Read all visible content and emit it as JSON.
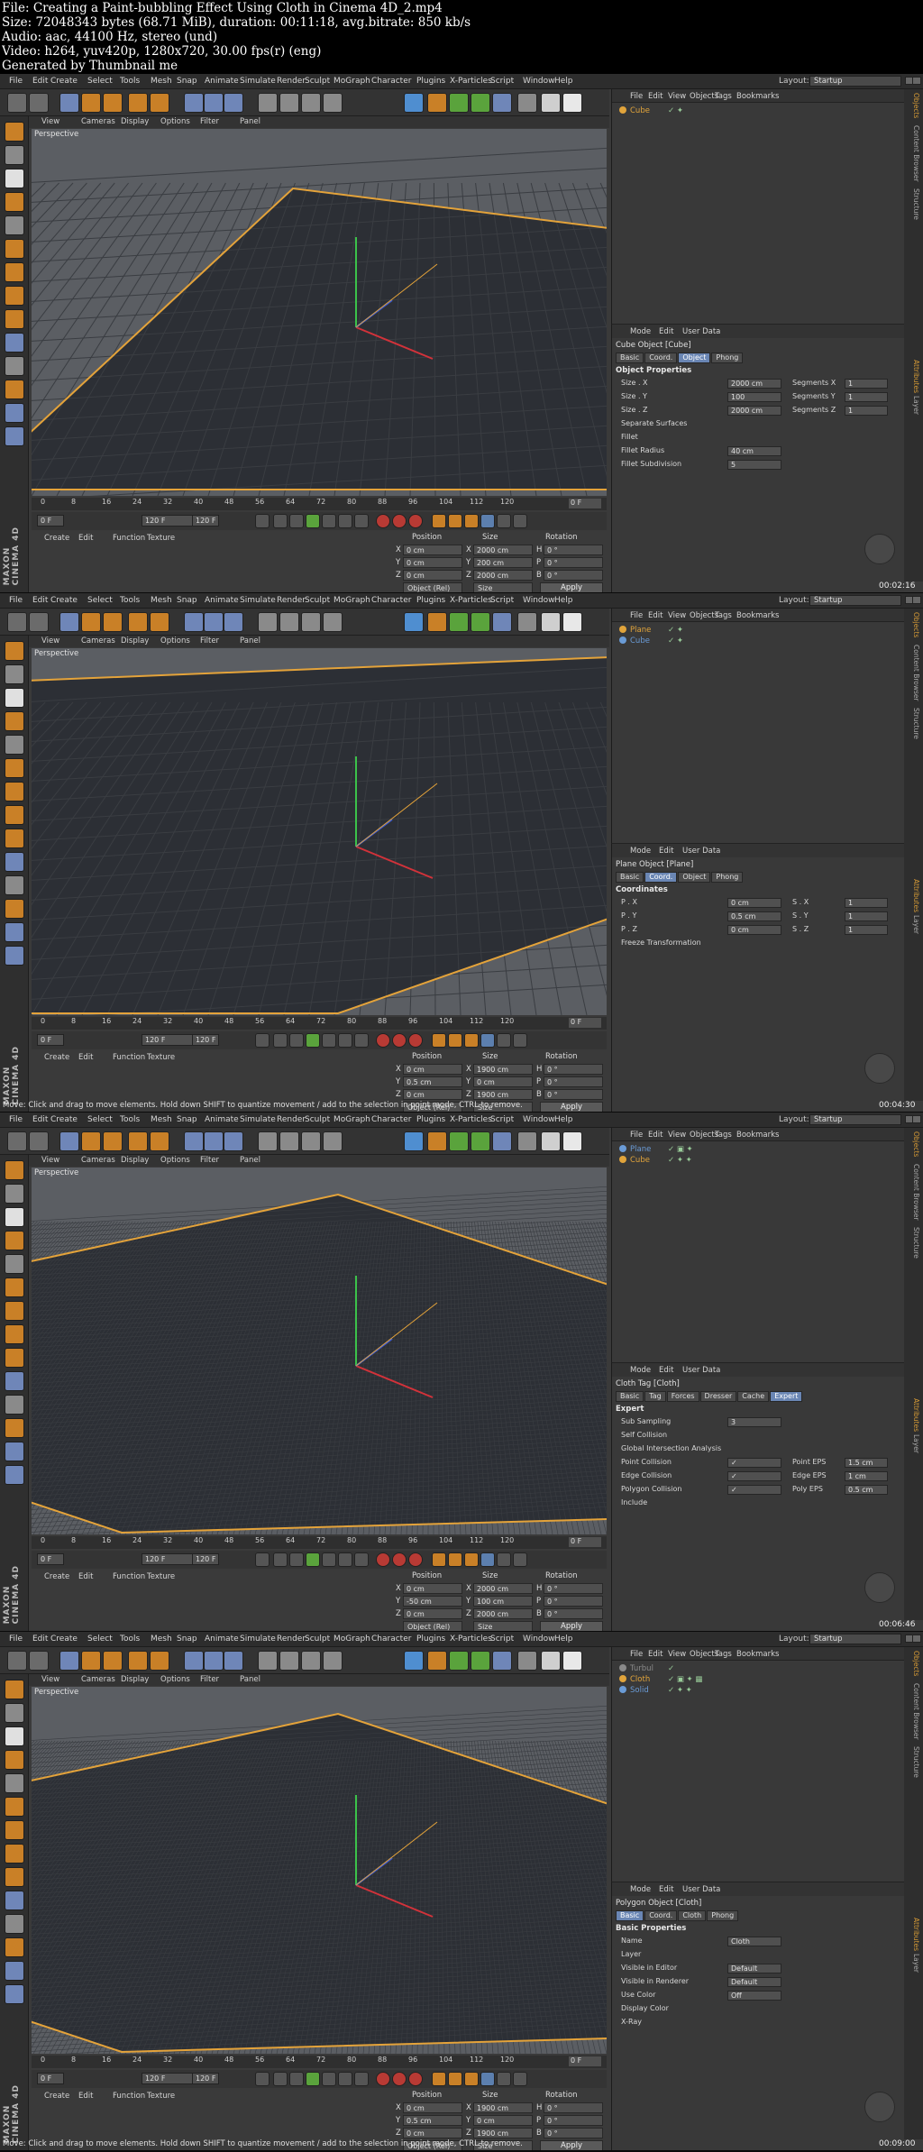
{
  "header": {
    "lines": [
      "File: Creating a Paint-bubbling Effect Using Cloth in Cinema 4D_2.mp4",
      "Size: 72048343 bytes (68.71 MiB), duration: 00:11:18, avg.bitrate: 850 kb/s",
      "Audio: aac, 44100 Hz, stereo (und)",
      "Video: h264, yuv420p, 1280x720, 30.00 fps(r) (eng)",
      "Generated by Thumbnail me"
    ]
  },
  "app": {
    "menu": [
      "File",
      "Edit",
      "Create",
      "Select",
      "Tools",
      "Mesh",
      "Snap",
      "Animate",
      "Simulate",
      "Render",
      "Sculpt",
      "MoGraph",
      "Character",
      "Plugins",
      "X-Particles",
      "Script",
      "Window",
      "Help"
    ],
    "layout_label": "Layout:",
    "layout_value": "Startup",
    "viewport_menu": [
      "View",
      "Cameras",
      "Display",
      "Options",
      "Filter",
      "Panel"
    ],
    "viewport_label": "Perspective",
    "timeline_ticks": [
      "0",
      "8",
      "16",
      "24",
      "32",
      "40",
      "48",
      "56",
      "64",
      "72",
      "80",
      "88",
      "96",
      "104",
      "112",
      "120"
    ],
    "frame_end_field": "0 F",
    "transport_fields": [
      "0 F",
      "120 F",
      "120 F"
    ],
    "material_menu": [
      "Create",
      "Edit",
      "Function",
      "Texture"
    ],
    "coord_headers": [
      "Position",
      "Size",
      "Rotation"
    ],
    "coord_axes": [
      "X",
      "Y",
      "Z"
    ],
    "coord_rot_axes": [
      "H",
      "P",
      "B"
    ],
    "coord_buttons": [
      "Object (Rel)",
      "Size",
      "Apply"
    ],
    "object_menu": [
      "File",
      "Edit",
      "View",
      "Objects",
      "Tags",
      "Bookmarks"
    ],
    "attr_menu": [
      "Mode",
      "Edit",
      "User Data"
    ],
    "brand_line1": "MAXON",
    "brand_line2": "CINEMA 4D",
    "side_tabs": [
      "Objects",
      "Content Browser",
      "Structure",
      "Attributes",
      "Layer"
    ]
  },
  "frames": [
    {
      "timestamp": "00:02:16",
      "status": "",
      "objects": [
        {
          "name": "Cube",
          "color": "#e1a43b",
          "icon": "cube-icon",
          "tags": "✓ ✦"
        }
      ],
      "attr_title": "Cube Object [Cube]",
      "attr_tabs": [
        "Basic",
        "Coord.",
        "Object",
        "Phong"
      ],
      "attr_active_tab": "Object",
      "attr_section": "Object Properties",
      "attr_rows": [
        {
          "label": "Size . X",
          "value": "2000 cm",
          "label2": "Segments X",
          "value2": "1"
        },
        {
          "label": "Size . Y",
          "value": "100",
          "label2": "Segments Y",
          "value2": "1"
        },
        {
          "label": "Size . Z",
          "value": "2000 cm",
          "label2": "Segments Z",
          "value2": "1"
        },
        {
          "label": "Separate Surfaces",
          "value": "",
          "label2": "",
          "value2": ""
        },
        {
          "label": "Fillet",
          "value": "",
          "label2": "",
          "value2": ""
        },
        {
          "label": "Fillet Radius",
          "value": "40 cm",
          "label2": "",
          "value2": ""
        },
        {
          "label": "Fillet Subdivision",
          "value": "5",
          "label2": "",
          "value2": ""
        }
      ],
      "coords": {
        "pos": [
          "0 cm",
          "0 cm",
          "0 cm"
        ],
        "size": [
          "2000 cm",
          "200 cm",
          "2000 cm"
        ],
        "rot": [
          "0 °",
          "0 °",
          "0 °"
        ]
      }
    },
    {
      "timestamp": "00:04:30",
      "status": "Move: Click and drag to move elements. Hold down SHIFT to quantize movement / add to the selection in point mode, CTRL to remove.",
      "objects": [
        {
          "name": "Plane",
          "color": "#e1a43b",
          "icon": "plane-icon",
          "tags": "✓ ✦"
        },
        {
          "name": "Cube",
          "color": "#6a9bd6",
          "icon": "cube-icon",
          "tags": "✓ ✦"
        }
      ],
      "attr_title": "Plane Object [Plane]",
      "attr_tabs": [
        "Basic",
        "Coord.",
        "Object",
        "Phong"
      ],
      "attr_active_tab": "Coord.",
      "attr_section": "Coordinates",
      "attr_rows": [
        {
          "label": "P . X",
          "value": "0 cm",
          "label2": "S . X",
          "value2": "1"
        },
        {
          "label": "P . Y",
          "value": "0.5 cm",
          "label2": "S . Y",
          "value2": "1"
        },
        {
          "label": "P . Z",
          "value": "0 cm",
          "label2": "S . Z",
          "value2": "1"
        },
        {
          "label": "Freeze Transformation",
          "value": "",
          "label2": "",
          "value2": ""
        }
      ],
      "coords": {
        "pos": [
          "0 cm",
          "0.5 cm",
          "0 cm"
        ],
        "size": [
          "1900 cm",
          "0 cm",
          "1900 cm"
        ],
        "rot": [
          "0 °",
          "0 °",
          "0 °"
        ]
      }
    },
    {
      "timestamp": "00:06:46",
      "status": "",
      "objects": [
        {
          "name": "Plane",
          "color": "#6a9bd6",
          "icon": "plane-icon",
          "tags": "✓ ▣ ✦"
        },
        {
          "name": "Cube",
          "color": "#e1a43b",
          "icon": "cube-icon",
          "tags": "✓ ✦ ✦"
        }
      ],
      "attr_title": "Cloth Tag [Cloth]",
      "attr_tabs": [
        "Basic",
        "Tag",
        "Forces",
        "Dresser",
        "Cache",
        "Expert"
      ],
      "attr_active_tab": "Expert",
      "attr_section": "Expert",
      "attr_rows": [
        {
          "label": "Sub Sampling",
          "value": "3",
          "label2": "",
          "value2": ""
        },
        {
          "label": "Self Collision",
          "value": "",
          "label2": "",
          "value2": ""
        },
        {
          "label": "Global Intersection Analysis",
          "value": "",
          "label2": "",
          "value2": ""
        },
        {
          "label": "Point Collision",
          "value": "✓",
          "label2": "Point EPS",
          "value2": "1.5 cm"
        },
        {
          "label": "Edge Collision",
          "value": "✓",
          "label2": "Edge EPS",
          "value2": "1 cm"
        },
        {
          "label": "Polygon Collision",
          "value": "✓",
          "label2": "Poly EPS",
          "value2": "0.5 cm"
        },
        {
          "label": "Include",
          "value": "",
          "label2": "",
          "value2": ""
        }
      ],
      "coords": {
        "pos": [
          "0 cm",
          "-50 cm",
          "0 cm"
        ],
        "size": [
          "2000 cm",
          "100 cm",
          "2000 cm"
        ],
        "rot": [
          "0 °",
          "0 °",
          "0 °"
        ]
      }
    },
    {
      "timestamp": "00:09:00",
      "status": "Move: Click and drag to move elements. Hold down SHIFT to quantize movement / add to the selection in point mode, CTRL to remove.",
      "objects": [
        {
          "name": "Turbul",
          "color": "#8a8a8a",
          "icon": "turbulence-icon",
          "tags": "✓"
        },
        {
          "name": "Cloth",
          "color": "#e1a43b",
          "icon": "cloth-icon",
          "tags": "✓ ▣ ✦ ▦"
        },
        {
          "name": "Solid",
          "color": "#6a9bd6",
          "icon": "solid-icon",
          "tags": "✓ ✦ ✦"
        }
      ],
      "attr_title": "Polygon Object [Cloth]",
      "attr_tabs": [
        "Basic",
        "Coord.",
        "Cloth",
        "Phong"
      ],
      "attr_active_tab": "Basic",
      "attr_section": "Basic Properties",
      "attr_rows": [
        {
          "label": "Name",
          "value": "Cloth",
          "label2": "",
          "value2": ""
        },
        {
          "label": "Layer",
          "value": "",
          "label2": "",
          "value2": ""
        },
        {
          "label": "Visible in Editor",
          "value": "Default",
          "label2": "",
          "value2": ""
        },
        {
          "label": "Visible in Renderer",
          "value": "Default",
          "label2": "",
          "value2": ""
        },
        {
          "label": "Use Color",
          "value": "Off",
          "label2": "",
          "value2": ""
        },
        {
          "label": "Display Color",
          "value": "",
          "label2": "",
          "value2": ""
        },
        {
          "label": "X-Ray",
          "value": "",
          "label2": "",
          "value2": ""
        }
      ],
      "coords": {
        "pos": [
          "0 cm",
          "0.5 cm",
          "0 cm"
        ],
        "size": [
          "1900 cm",
          "0 cm",
          "1900 cm"
        ],
        "rot": [
          "0 °",
          "0 °",
          "0 °"
        ]
      }
    }
  ]
}
